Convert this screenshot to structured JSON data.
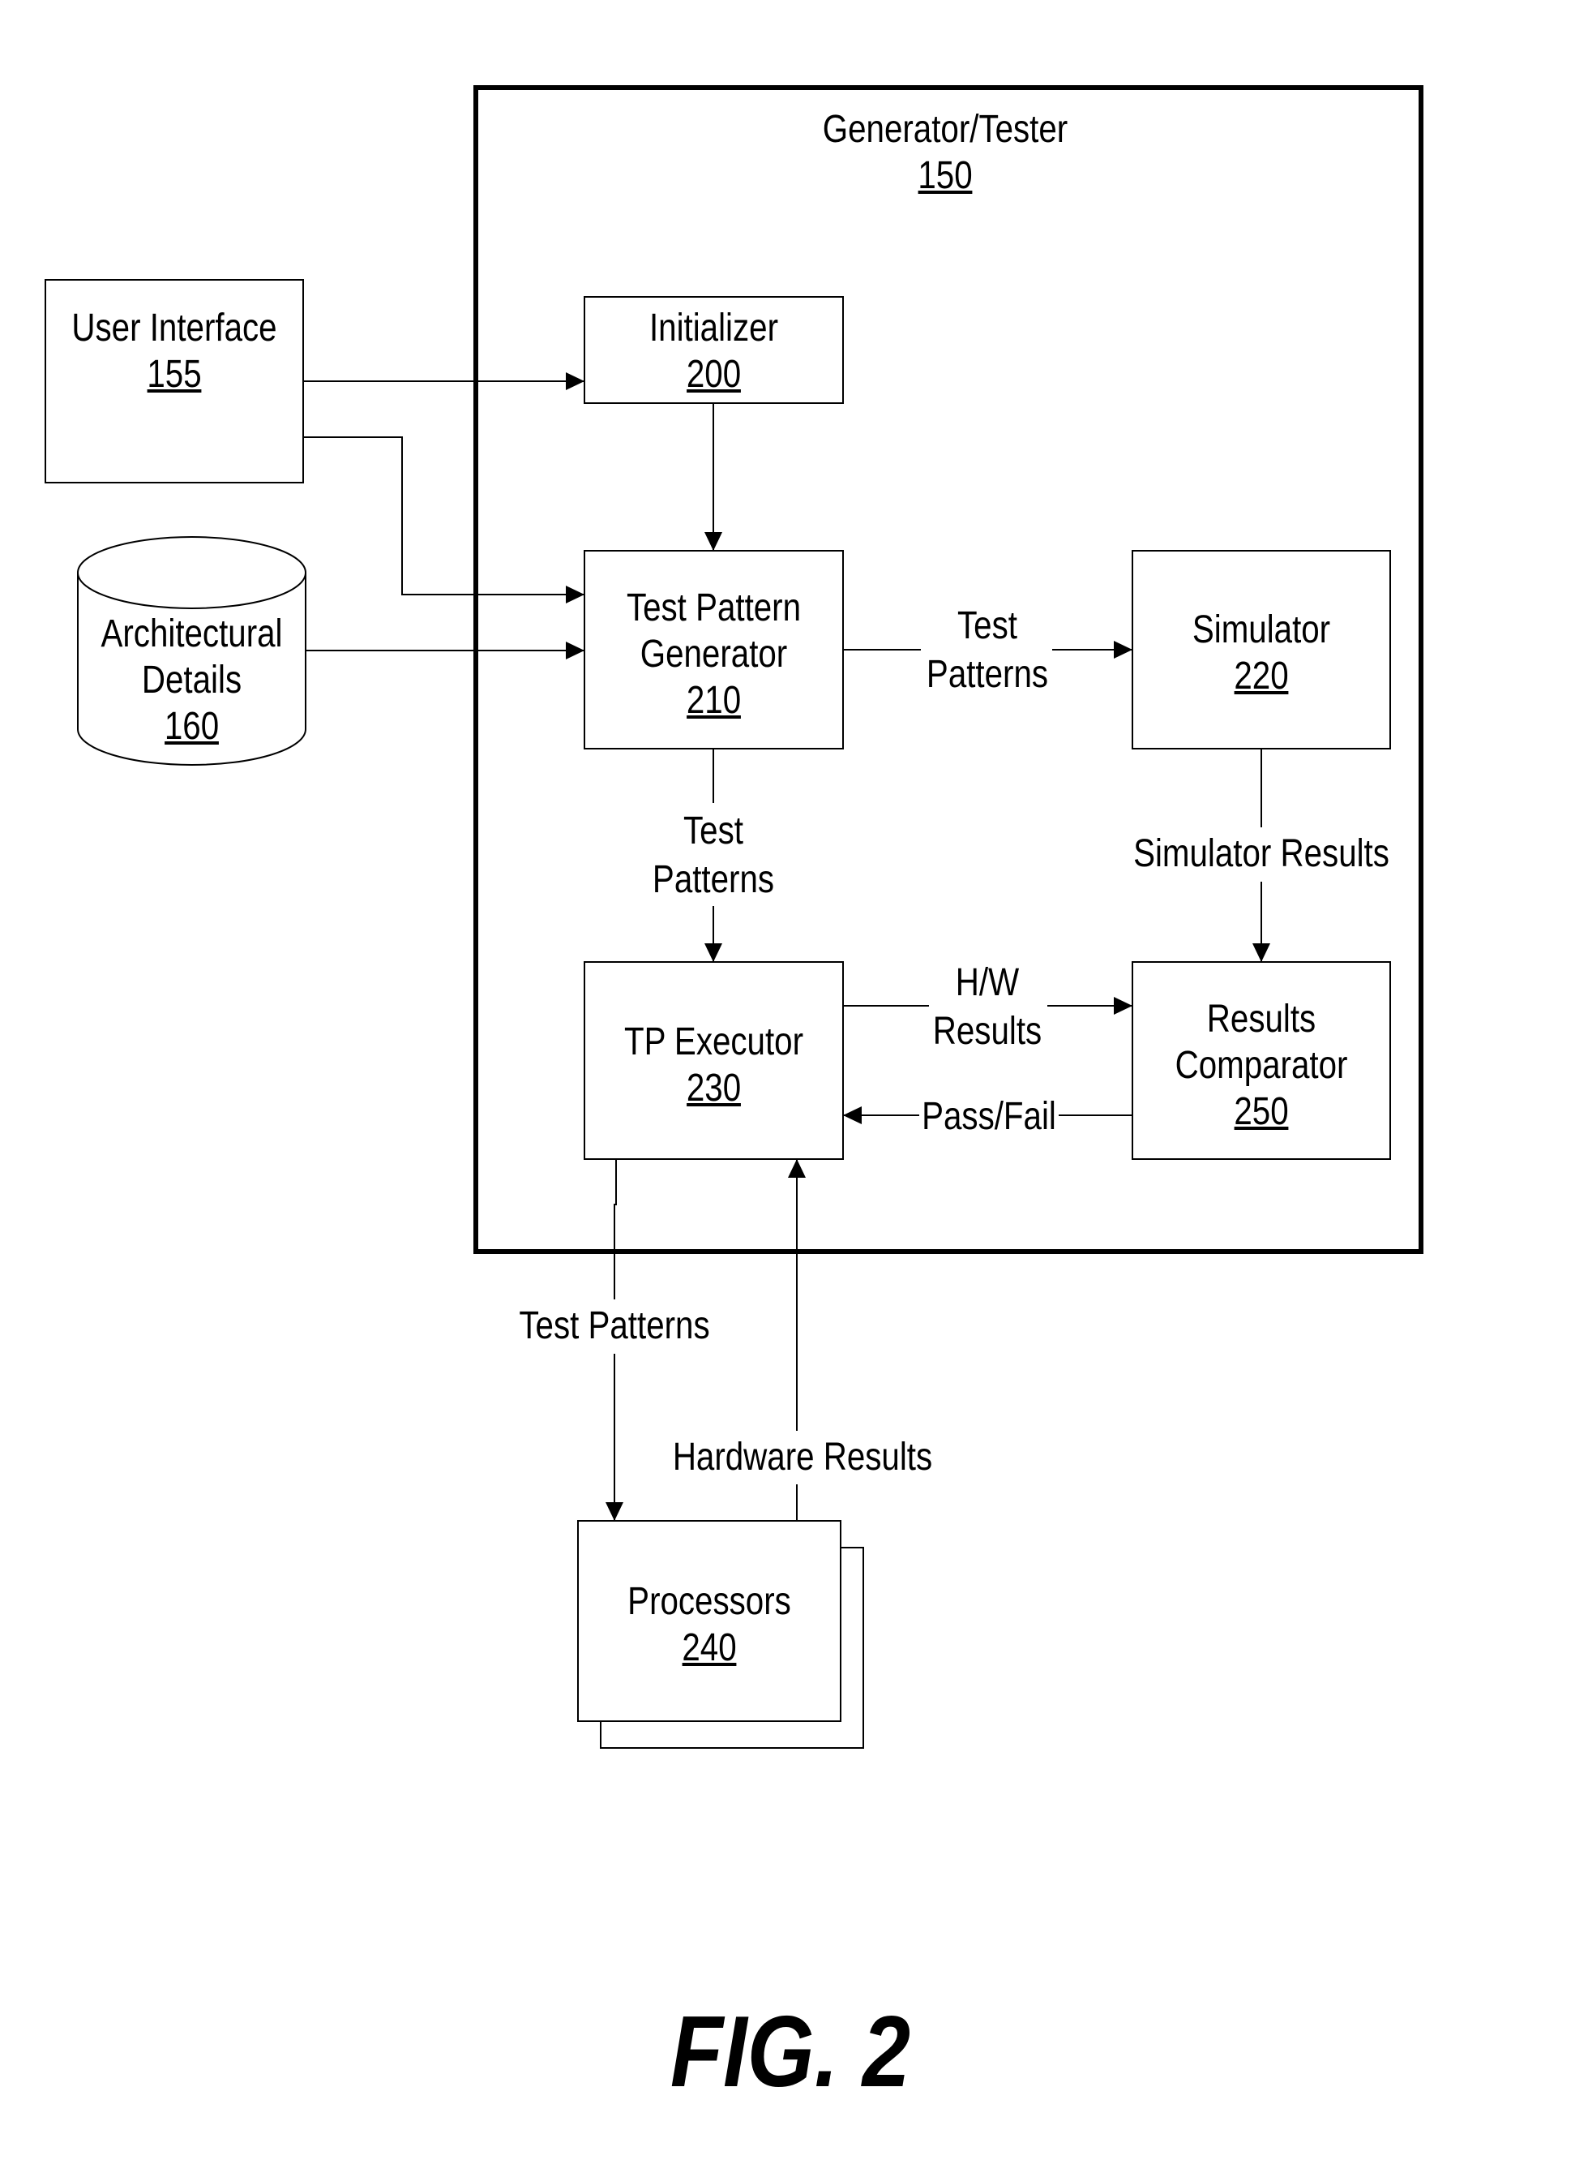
{
  "figure_label": "FIG. 2",
  "container": {
    "title": "Generator/Tester",
    "ref": "150"
  },
  "blocks": {
    "user_interface": {
      "lines": [
        "User Interface"
      ],
      "ref": "155"
    },
    "architectural_details": {
      "lines": [
        "Architectural",
        "Details"
      ],
      "ref": "160",
      "shape": "cylinder"
    },
    "initializer": {
      "lines": [
        "Initializer"
      ],
      "ref": "200"
    },
    "test_pattern_generator": {
      "lines": [
        "Test Pattern",
        "Generator"
      ],
      "ref": "210"
    },
    "simulator": {
      "lines": [
        "Simulator"
      ],
      "ref": "220"
    },
    "tp_executor": {
      "lines": [
        "TP Executor"
      ],
      "ref": "230"
    },
    "processors": {
      "lines": [
        "Processors"
      ],
      "ref": "240",
      "shape": "stacked"
    },
    "results_comparator": {
      "lines": [
        "Results",
        "Comparator"
      ],
      "ref": "250"
    }
  },
  "edges": [
    {
      "from": "user_interface",
      "to": "initializer",
      "label": []
    },
    {
      "from": "user_interface",
      "to": "test_pattern_generator",
      "label": []
    },
    {
      "from": "architectural_details",
      "to": "test_pattern_generator",
      "label": []
    },
    {
      "from": "initializer",
      "to": "test_pattern_generator",
      "label": []
    },
    {
      "from": "test_pattern_generator",
      "to": "simulator",
      "label": [
        "Test",
        "Patterns"
      ]
    },
    {
      "from": "test_pattern_generator",
      "to": "tp_executor",
      "label": [
        "Test",
        "Patterns"
      ]
    },
    {
      "from": "simulator",
      "to": "results_comparator",
      "label": [
        "Simulator Results"
      ]
    },
    {
      "from": "tp_executor",
      "to": "results_comparator",
      "label": [
        "H/W",
        "Results"
      ]
    },
    {
      "from": "results_comparator",
      "to": "tp_executor",
      "label": [
        "Pass/Fail"
      ]
    },
    {
      "from": "tp_executor",
      "to": "processors",
      "label": [
        "Test Patterns"
      ]
    },
    {
      "from": "processors",
      "to": "tp_executor",
      "label": [
        "Hardware Results"
      ]
    }
  ]
}
